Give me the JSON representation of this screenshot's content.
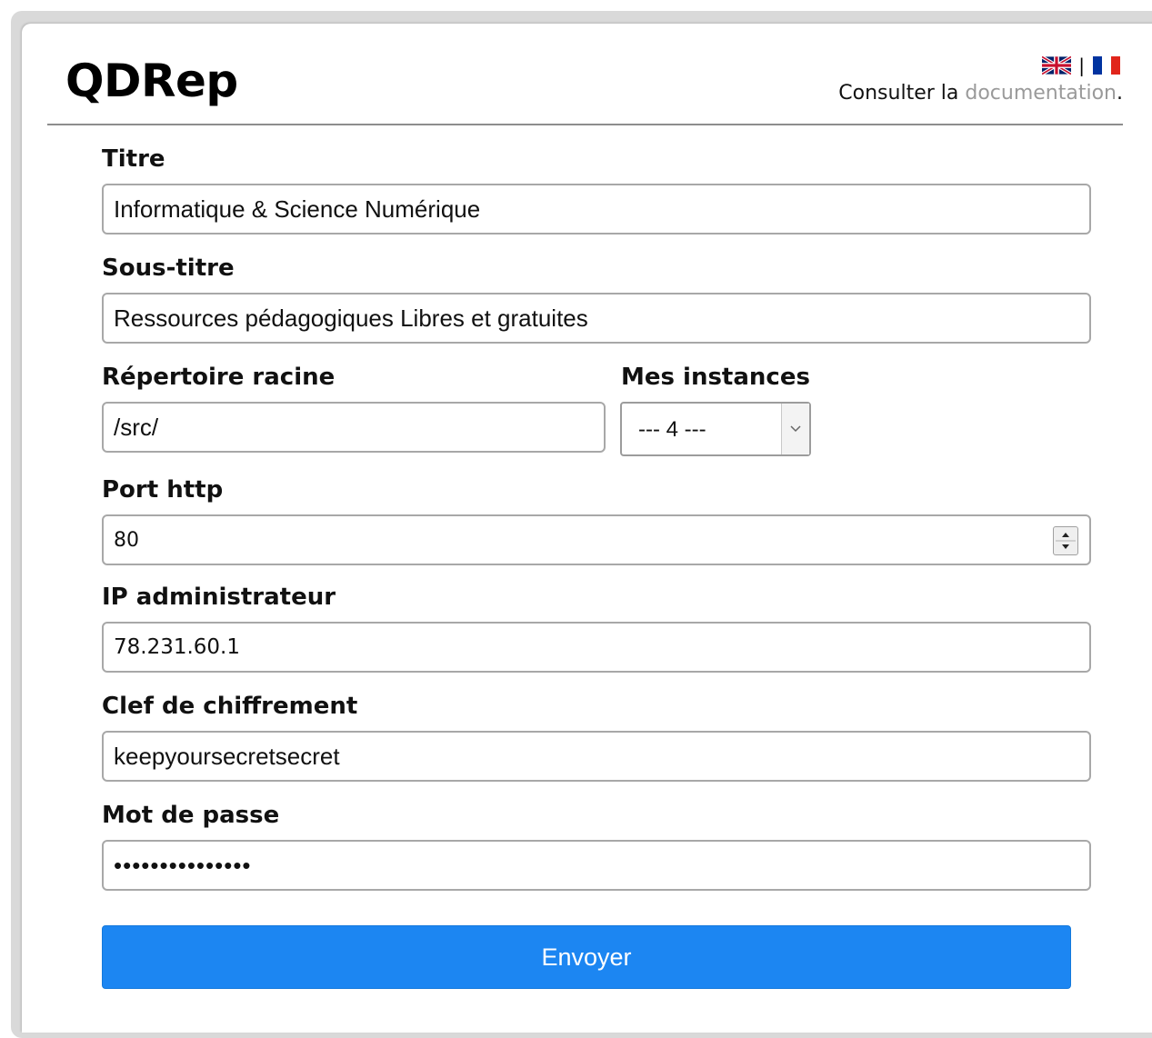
{
  "header": {
    "logo": "QDRep",
    "lang_separator": "|",
    "doc_prefix": "Consulter la ",
    "doc_link": "documentation",
    "doc_suffix": "."
  },
  "form": {
    "titre": {
      "label": "Titre",
      "value": "Informatique & Science Numérique"
    },
    "sous_titre": {
      "label": "Sous-titre",
      "value": "Ressources pédagogiques Libres et gratuites"
    },
    "repertoire": {
      "label": "Répertoire racine",
      "value": "/src/"
    },
    "instances": {
      "label": "Mes instances",
      "value": "--- 4 ---"
    },
    "port": {
      "label": "Port http",
      "value": "80"
    },
    "ip": {
      "label": "IP administrateur",
      "value": "78.231.60.1"
    },
    "clef": {
      "label": "Clef de chiffrement",
      "value": "keepyoursecretsecret"
    },
    "mdp": {
      "label": "Mot de passe",
      "value": "•••••••••••••••"
    },
    "submit_label": "Envoyer"
  },
  "colors": {
    "button": "#1c86f2",
    "link": "#9a9a9a"
  },
  "icons": {
    "english_flag": "uk-flag-icon",
    "french_flag": "fr-flag-icon",
    "select_arrow": "chevron-down-icon",
    "spinner": "number-spinner-icon"
  }
}
